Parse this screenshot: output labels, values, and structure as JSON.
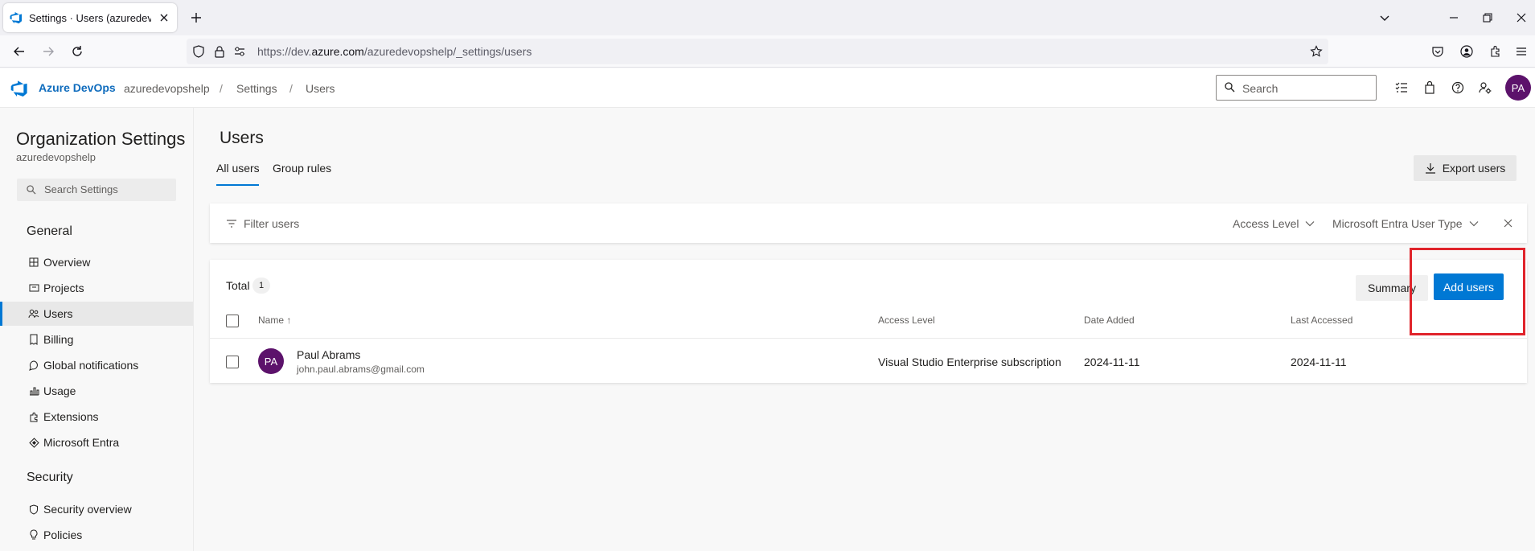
{
  "browser": {
    "tab_title": "Settings · Users (azuredevopshelp)",
    "url_prefix": "https://dev.",
    "url_host": "azure.com",
    "url_path": "/azuredevopshelp/_settings/users"
  },
  "header": {
    "brand": "Azure DevOps",
    "breadcrumbs": [
      "azuredevopshelp",
      "Settings",
      "Users"
    ],
    "breadcrumb_separator": "/",
    "search_placeholder": "Search",
    "avatar_initials": "PA"
  },
  "sidebar": {
    "title": "Organization Settings",
    "subtitle": "azuredevopshelp",
    "search_placeholder": "Search Settings",
    "sections": [
      {
        "title": "General",
        "items": [
          {
            "label": "Overview",
            "icon": "overview-icon"
          },
          {
            "label": "Projects",
            "icon": "projects-icon"
          },
          {
            "label": "Users",
            "icon": "users-icon",
            "selected": true
          },
          {
            "label": "Billing",
            "icon": "billing-icon"
          },
          {
            "label": "Global notifications",
            "icon": "notifications-icon"
          },
          {
            "label": "Usage",
            "icon": "usage-icon"
          },
          {
            "label": "Extensions",
            "icon": "extensions-icon"
          },
          {
            "label": "Microsoft Entra",
            "icon": "entra-icon"
          }
        ]
      },
      {
        "title": "Security",
        "items": [
          {
            "label": "Security overview",
            "icon": "shield-icon"
          },
          {
            "label": "Policies",
            "icon": "policies-icon"
          }
        ]
      }
    ]
  },
  "main": {
    "title": "Users",
    "tabs": [
      {
        "label": "All users",
        "selected": true
      },
      {
        "label": "Group rules",
        "selected": false
      }
    ],
    "export_label": "Export users",
    "filter_placeholder": "Filter users",
    "filters": [
      "Access Level",
      "Microsoft Entra User Type"
    ],
    "total_label": "Total",
    "total_count": "1",
    "summary_label": "Summary",
    "add_users_label": "Add users",
    "columns": [
      "Name",
      "Access Level",
      "Date Added",
      "Last Accessed"
    ],
    "sort_indicator": "↑",
    "rows": [
      {
        "initials": "PA",
        "name": "Paul Abrams",
        "email": "john.paul.abrams@gmail.com",
        "access_level": "Visual Studio Enterprise subscription",
        "date_added": "2024-11-11",
        "last_accessed": "2024-11-11"
      }
    ]
  },
  "colors": {
    "accent": "#0078d4",
    "brand": "#0f6cbd",
    "avatar": "#5c126b",
    "highlight": "#e0242b"
  }
}
